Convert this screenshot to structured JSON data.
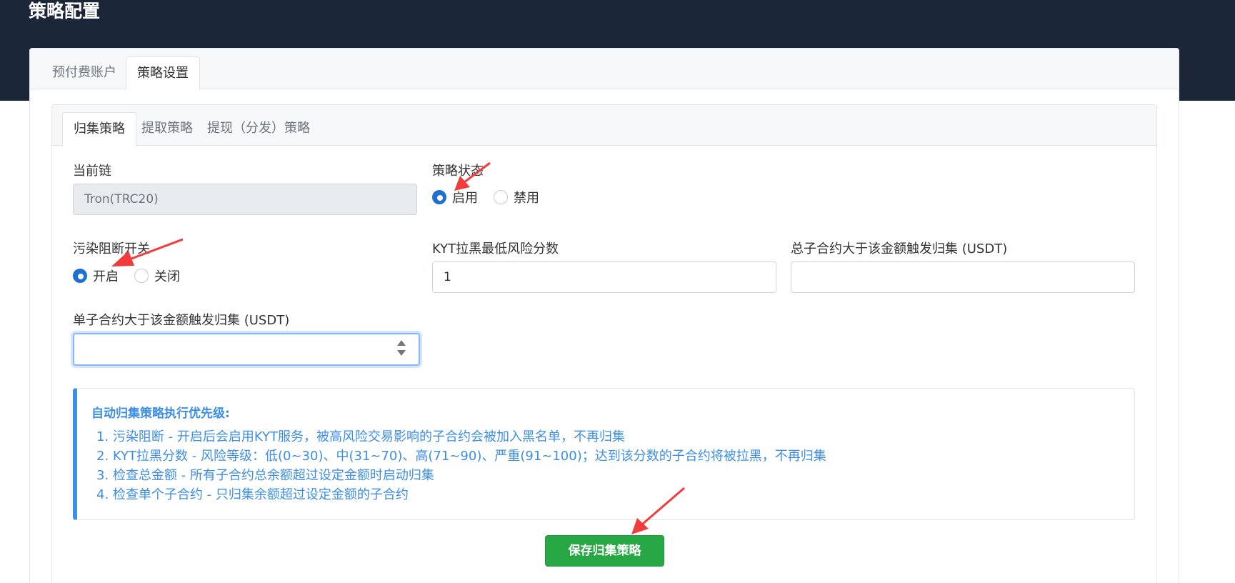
{
  "page": {
    "title": "策略配置"
  },
  "outer_tabs": [
    {
      "label": "预付费账户"
    },
    {
      "label": "策略设置"
    }
  ],
  "inner_tabs": [
    {
      "label": "归集策略"
    },
    {
      "label": "提取策略"
    },
    {
      "label": "提现（分发）策略"
    }
  ],
  "form": {
    "current_chain": {
      "label": "当前链",
      "value": "Tron(TRC20)"
    },
    "strategy_status": {
      "label": "策略状态",
      "options": [
        "启用",
        "禁用"
      ],
      "selected": "启用"
    },
    "pollution_block": {
      "label": "污染阻断开关",
      "options": [
        "开启",
        "关闭"
      ],
      "selected": "开启"
    },
    "kyt_score": {
      "label": "KYT拉黑最低风险分数",
      "value": "1"
    },
    "total_amount": {
      "label": "总子合约大于该金额触发归集 (USDT)",
      "value": ""
    },
    "single_amount": {
      "label": "单子合约大于该金额触发归集 (USDT)",
      "value": ""
    }
  },
  "info": {
    "title": "自动归集策略执行优先级:",
    "items": [
      "1. 污染阻断 - 开启后会启用KYT服务，被高风险交易影响的子合约会被加入黑名单，不再归集",
      "2. KYT拉黑分数 - 风险等级：低(0~30)、中(31~70)、高(71~90)、严重(91~100)；达到该分数的子合约将被拉黑，不再归集",
      "3. 检查总金额 - 所有子合约总余额超过设定金额时启动归集",
      "4. 检查单个子合约 - 只归集余额超过设定金额的子合约"
    ]
  },
  "save_button": {
    "label": "保存归集策略"
  },
  "colors": {
    "header_bg": "#1b2638",
    "accent_blue": "#3d8ee6",
    "save_green": "#28a745",
    "arrow_red": "#f03c3c"
  }
}
